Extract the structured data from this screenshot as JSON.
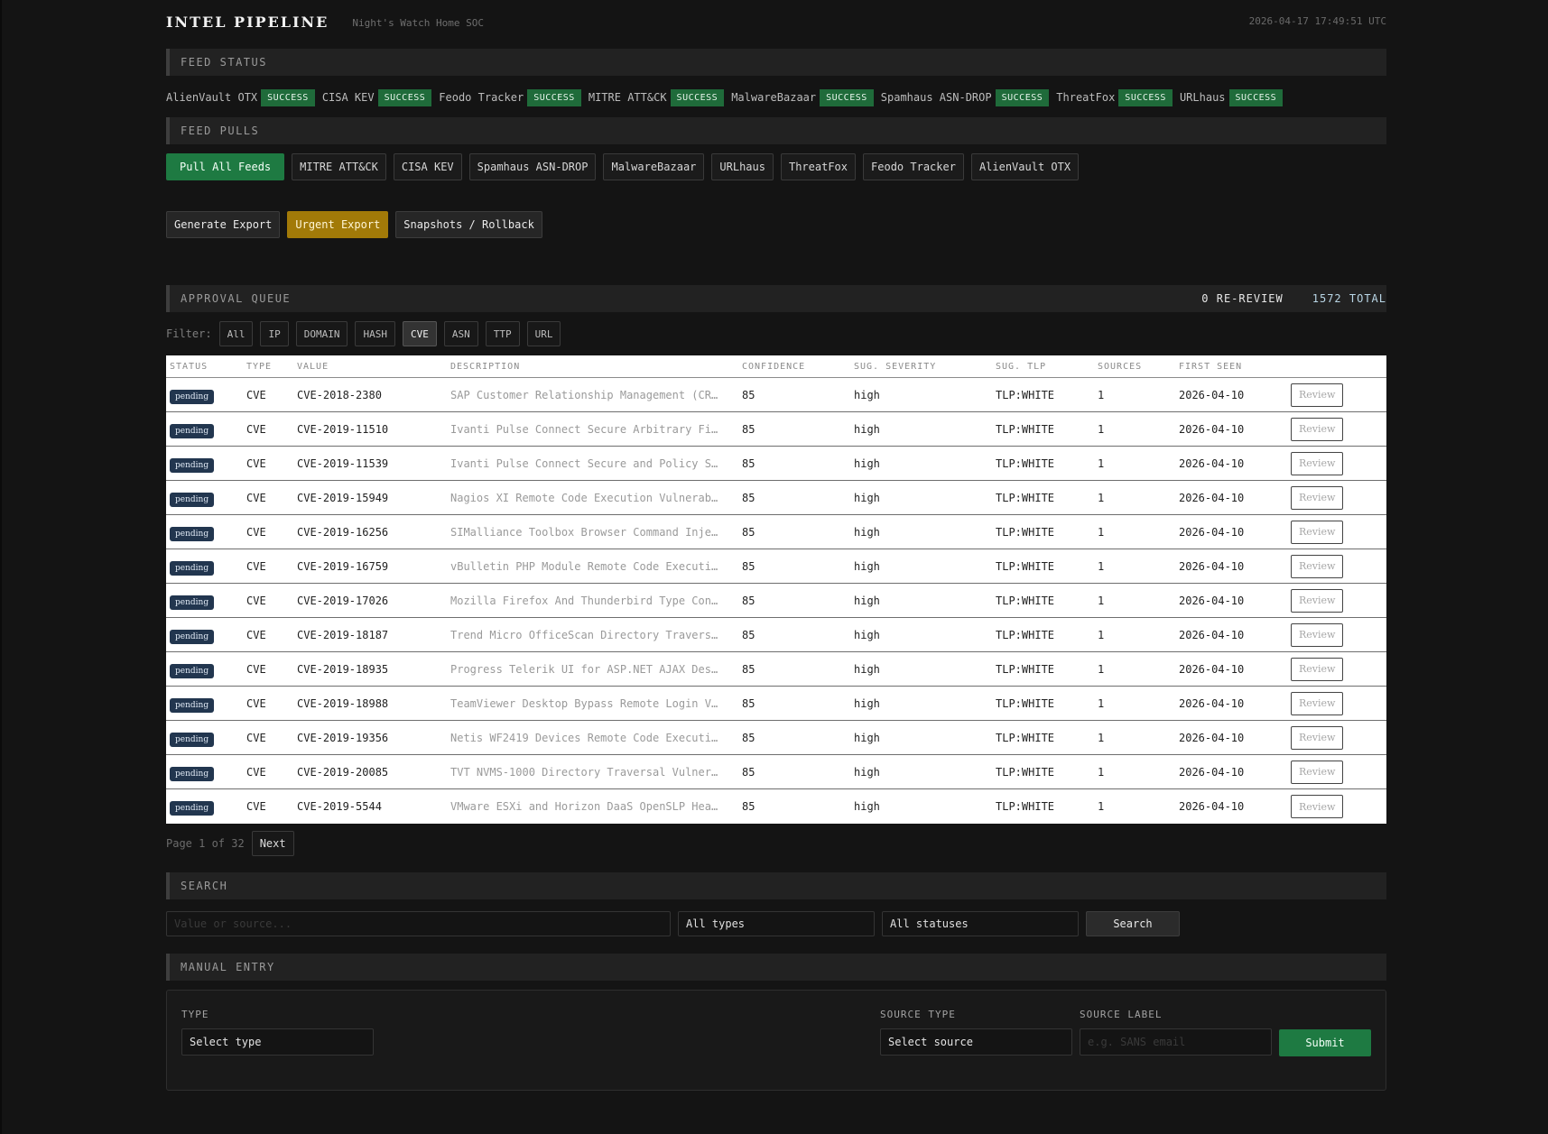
{
  "header": {
    "title": "INTEL PIPELINE",
    "subtitle": "Night's Watch Home SOC",
    "clock": "2026-04-17 17:49:51 UTC"
  },
  "feed_status": {
    "title": "FEED STATUS",
    "items": [
      {
        "name": "AlienVault OTX",
        "status": "SUCCESS"
      },
      {
        "name": "CISA KEV",
        "status": "SUCCESS"
      },
      {
        "name": "Feodo Tracker",
        "status": "SUCCESS"
      },
      {
        "name": "MITRE ATT&CK",
        "status": "SUCCESS"
      },
      {
        "name": "MalwareBazaar",
        "status": "SUCCESS"
      },
      {
        "name": "Spamhaus ASN-DROP",
        "status": "SUCCESS"
      },
      {
        "name": "ThreatFox",
        "status": "SUCCESS"
      },
      {
        "name": "URLhaus",
        "status": "SUCCESS"
      }
    ]
  },
  "feed_pulls": {
    "title": "FEED PULLS",
    "pull_all": "Pull All Feeds",
    "feeds": [
      "MITRE ATT&CK",
      "CISA KEV",
      "Spamhaus ASN-DROP",
      "MalwareBazaar",
      "URLhaus",
      "ThreatFox",
      "Feodo Tracker",
      "AlienVault OTX"
    ]
  },
  "actions": {
    "generate_export": "Generate Export",
    "urgent_export": "Urgent Export",
    "snapshots": "Snapshots / Rollback"
  },
  "approval": {
    "title": "APPROVAL QUEUE",
    "rereview": "0 RE-REVIEW",
    "total": "1572 TOTAL",
    "filter_label": "Filter:",
    "filters": [
      "All",
      "IP",
      "DOMAIN",
      "HASH",
      "CVE",
      "ASN",
      "TTP",
      "URL"
    ],
    "active_filter": "CVE",
    "columns": {
      "status": "STATUS",
      "type": "TYPE",
      "value": "VALUE",
      "description": "DESCRIPTION",
      "confidence": "CONFIDENCE",
      "severity": "SUG. SEVERITY",
      "tlp": "SUG. TLP",
      "sources": "SOURCES",
      "first_seen": "FIRST SEEN"
    },
    "review_label": "Review",
    "rows": [
      {
        "status": "pending",
        "type": "CVE",
        "value": "CVE-2018-2380",
        "description": "SAP Customer Relationship Management (CR…",
        "confidence": "85",
        "severity": "high",
        "tlp": "TLP:WHITE",
        "sources": "1",
        "first_seen": "2026-04-10"
      },
      {
        "status": "pending",
        "type": "CVE",
        "value": "CVE-2019-11510",
        "description": "Ivanti Pulse Connect Secure Arbitrary Fi…",
        "confidence": "85",
        "severity": "high",
        "tlp": "TLP:WHITE",
        "sources": "1",
        "first_seen": "2026-04-10"
      },
      {
        "status": "pending",
        "type": "CVE",
        "value": "CVE-2019-11539",
        "description": "Ivanti Pulse Connect Secure and Policy S…",
        "confidence": "85",
        "severity": "high",
        "tlp": "TLP:WHITE",
        "sources": "1",
        "first_seen": "2026-04-10"
      },
      {
        "status": "pending",
        "type": "CVE",
        "value": "CVE-2019-15949",
        "description": "Nagios XI Remote Code Execution Vulnerab…",
        "confidence": "85",
        "severity": "high",
        "tlp": "TLP:WHITE",
        "sources": "1",
        "first_seen": "2026-04-10"
      },
      {
        "status": "pending",
        "type": "CVE",
        "value": "CVE-2019-16256",
        "description": "SIMalliance Toolbox Browser Command Inje…",
        "confidence": "85",
        "severity": "high",
        "tlp": "TLP:WHITE",
        "sources": "1",
        "first_seen": "2026-04-10"
      },
      {
        "status": "pending",
        "type": "CVE",
        "value": "CVE-2019-16759",
        "description": "vBulletin PHP Module Remote Code Executi…",
        "confidence": "85",
        "severity": "high",
        "tlp": "TLP:WHITE",
        "sources": "1",
        "first_seen": "2026-04-10"
      },
      {
        "status": "pending",
        "type": "CVE",
        "value": "CVE-2019-17026",
        "description": "Mozilla Firefox And Thunderbird Type Con…",
        "confidence": "85",
        "severity": "high",
        "tlp": "TLP:WHITE",
        "sources": "1",
        "first_seen": "2026-04-10"
      },
      {
        "status": "pending",
        "type": "CVE",
        "value": "CVE-2019-18187",
        "description": "Trend Micro OfficeScan Directory Travers…",
        "confidence": "85",
        "severity": "high",
        "tlp": "TLP:WHITE",
        "sources": "1",
        "first_seen": "2026-04-10"
      },
      {
        "status": "pending",
        "type": "CVE",
        "value": "CVE-2019-18935",
        "description": "Progress Telerik UI for ASP.NET AJAX Des…",
        "confidence": "85",
        "severity": "high",
        "tlp": "TLP:WHITE",
        "sources": "1",
        "first_seen": "2026-04-10"
      },
      {
        "status": "pending",
        "type": "CVE",
        "value": "CVE-2019-18988",
        "description": "TeamViewer Desktop Bypass Remote Login V…",
        "confidence": "85",
        "severity": "high",
        "tlp": "TLP:WHITE",
        "sources": "1",
        "first_seen": "2026-04-10"
      },
      {
        "status": "pending",
        "type": "CVE",
        "value": "CVE-2019-19356",
        "description": "Netis WF2419 Devices Remote Code Executi…",
        "confidence": "85",
        "severity": "high",
        "tlp": "TLP:WHITE",
        "sources": "1",
        "first_seen": "2026-04-10"
      },
      {
        "status": "pending",
        "type": "CVE",
        "value": "CVE-2019-20085",
        "description": "TVT NVMS-1000 Directory Traversal Vulner…",
        "confidence": "85",
        "severity": "high",
        "tlp": "TLP:WHITE",
        "sources": "1",
        "first_seen": "2026-04-10"
      },
      {
        "status": "pending",
        "type": "CVE",
        "value": "CVE-2019-5544",
        "description": "VMware ESXi and Horizon DaaS OpenSLP Hea…",
        "confidence": "85",
        "severity": "high",
        "tlp": "TLP:WHITE",
        "sources": "1",
        "first_seen": "2026-04-10"
      }
    ],
    "page_text": "Page 1 of 32",
    "next_label": "Next"
  },
  "search": {
    "title": "SEARCH",
    "placeholder": "Value or source...",
    "types_value": "All types",
    "statuses_value": "All statuses",
    "button": "Search"
  },
  "manual": {
    "title": "MANUAL ENTRY",
    "type_label": "TYPE",
    "type_value": "Select type",
    "source_type_label": "SOURCE TYPE",
    "source_type_value": "Select source",
    "source_label_label": "SOURCE LABEL",
    "source_label_placeholder": "e.g. SANS email",
    "submit": "Submit"
  },
  "colors": {
    "success": "#1f6b3a",
    "primary_green": "#1e7a42",
    "urgent_gold": "#a27a08",
    "pending_badge": "#22364f"
  }
}
